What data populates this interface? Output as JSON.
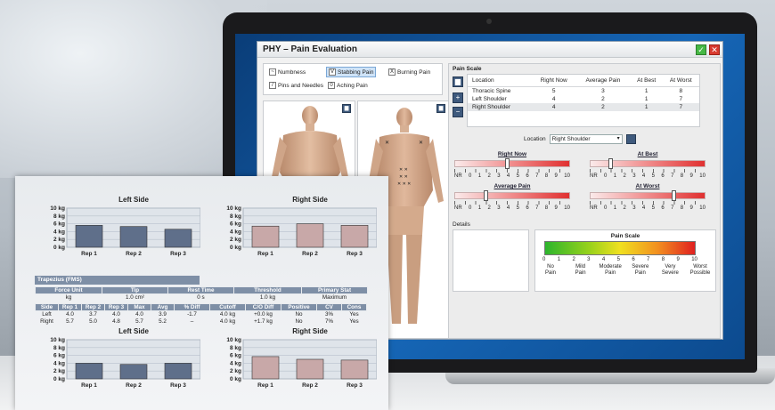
{
  "colors": {
    "accent": "#7e8fa6",
    "bar_blue": "#5f6f8a",
    "bar_pink": "#c8a8a8",
    "window_bg": "#f2f2f2"
  },
  "app": {
    "title": "PHY – Pain Evaluation",
    "ok_icon": "check-icon",
    "close_icon": "close-icon"
  },
  "legend": {
    "items": [
      {
        "symbol": "~",
        "label": "Numbness"
      },
      {
        "symbol": "V",
        "label": "Stabbing Pain",
        "selected": true
      },
      {
        "symbol": "X",
        "label": "Burning Pain"
      },
      {
        "symbol": "/",
        "label": "Pins and Needles"
      },
      {
        "symbol": "0",
        "label": "Aching Pain"
      }
    ]
  },
  "pain_scale_panel": {
    "title": "Pain Scale",
    "table": {
      "headers": [
        "Location",
        "Right Now",
        "Average Pain",
        "At Best",
        "At Worst"
      ],
      "rows": [
        [
          "Thoracic Spine",
          "5",
          "3",
          "1",
          "8"
        ],
        [
          "Left Shoulder",
          "4",
          "2",
          "1",
          "7"
        ],
        [
          "Right Shoulder",
          "4",
          "2",
          "1",
          "7"
        ]
      ]
    },
    "location_label": "Location",
    "location_value": "Right Shoulder",
    "sliders": [
      {
        "label": "Right Now",
        "value": 4
      },
      {
        "label": "At Best",
        "value": 1
      },
      {
        "label": "Average Pain",
        "value": 2
      },
      {
        "label": "At Worst",
        "value": 7
      }
    ],
    "slider_ticks": [
      "NR",
      "0",
      "1",
      "2",
      "3",
      "4",
      "5",
      "6",
      "7",
      "8",
      "9",
      "10"
    ],
    "details_label": "Details",
    "scale": {
      "title": "Pain Scale",
      "numbers": [
        "0",
        "1",
        "2",
        "3",
        "4",
        "5",
        "6",
        "7",
        "8",
        "9",
        "10"
      ],
      "words": [
        [
          "No",
          "Pain"
        ],
        [
          "Mild",
          "Pain"
        ],
        [
          "Moderate",
          "Pain"
        ],
        [
          "Severe",
          "Pain"
        ],
        [
          "Very",
          "Severe"
        ],
        [
          "Worst",
          "Possible"
        ]
      ]
    }
  },
  "report": {
    "table_title": "Trapezius (FMS)",
    "summary": {
      "headers": [
        "Force Unit",
        "Tip",
        "Rest Time",
        "Threshold",
        "Primary Stat"
      ],
      "values": [
        "kg",
        "1.0 cm²",
        "0 s",
        "1.0 kg",
        "Maximum"
      ]
    },
    "detail": {
      "headers": [
        "Side",
        "Rep 1",
        "Rep 2",
        "Rep 3",
        "Max",
        "Avg",
        "% Diff",
        "Cutoff",
        "C/O Diff",
        "Positive",
        "CV",
        "Cons"
      ],
      "rows": [
        [
          "Left",
          "4.0",
          "3.7",
          "4.0",
          "4.0",
          "3.9",
          "-1.7",
          "4.0 kg",
          "+0.0 kg",
          "No",
          "3%",
          "Yes"
        ],
        [
          "Right",
          "5.7",
          "5.0",
          "4.8",
          "5.7",
          "5.2",
          "–",
          "4.0 kg",
          "+1.7 kg",
          "No",
          "7%",
          "Yes"
        ]
      ]
    }
  },
  "chart_data": [
    {
      "type": "bar",
      "title": "Left Side",
      "categories": [
        "Rep 1",
        "Rep 2",
        "Rep 3"
      ],
      "values": [
        5.6,
        5.3,
        4.6
      ],
      "yticks": [
        "10 kg",
        "8 kg",
        "6 kg",
        "4 kg",
        "2 kg",
        "0 kg"
      ],
      "ylim": [
        0,
        10
      ],
      "color": "#5f6f8a"
    },
    {
      "type": "bar",
      "title": "Right Side",
      "categories": [
        "Rep 1",
        "Rep 2",
        "Rep 3"
      ],
      "values": [
        5.4,
        6.0,
        5.6
      ],
      "yticks": [
        "10 kg",
        "8 kg",
        "6 kg",
        "4 kg",
        "2 kg",
        "0 kg"
      ],
      "ylim": [
        0,
        10
      ],
      "color": "#c8a8a8"
    },
    {
      "type": "bar",
      "title": "Left Side",
      "categories": [
        "Rep 1",
        "Rep 2",
        "Rep 3"
      ],
      "values": [
        4.0,
        3.7,
        4.0
      ],
      "yticks": [
        "10 kg",
        "8 kg",
        "6 kg",
        "4 kg",
        "2 kg",
        "0 kg"
      ],
      "ylim": [
        0,
        10
      ],
      "color": "#5f6f8a"
    },
    {
      "type": "bar",
      "title": "Right Side",
      "categories": [
        "Rep 1",
        "Rep 2",
        "Rep 3"
      ],
      "values": [
        5.7,
        5.0,
        4.8
      ],
      "yticks": [
        "10 kg",
        "8 kg",
        "6 kg",
        "4 kg",
        "2 kg",
        "0 kg"
      ],
      "ylim": [
        0,
        10
      ],
      "color": "#c8a8a8"
    }
  ]
}
